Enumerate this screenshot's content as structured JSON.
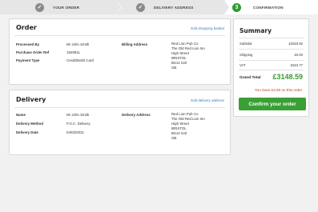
{
  "progress": {
    "steps": [
      {
        "label": "YOUR ORDER",
        "state": "complete"
      },
      {
        "label": "DELIVERY ADDRESS",
        "state": "complete"
      },
      {
        "label": "CONFIRMATION",
        "state": "current",
        "number": "3"
      }
    ],
    "check_glyph": "✓"
  },
  "order": {
    "title": "Order",
    "edit_label": "Edit shopping basket",
    "fields": [
      {
        "label": "Processed By",
        "value": "Mr John Smith"
      },
      {
        "label": "Purchase Order Ref",
        "value": "1629911"
      },
      {
        "label": "Payment Type",
        "value": "Credit/Debit Card"
      }
    ],
    "billing_label": "Billing Address",
    "billing_lines": [
      "Red Lion Pub Co",
      "The Old Red Lion Inn",
      "High Street",
      "BRISTOL",
      "BS14 0JZ",
      "GB"
    ]
  },
  "delivery": {
    "title": "Delivery",
    "edit_label": "Edit delivery address",
    "fields": [
      {
        "label": "Name",
        "value": "Mr John Smith"
      },
      {
        "label": "Delivery Method",
        "value": "F.O.C. Delivery"
      },
      {
        "label": "Delivery Date",
        "value": "04/03/2021"
      }
    ],
    "address_label": "Delivery Address",
    "address_lines": [
      "Red Lion Pub Co",
      "The Old Red Lion Inn",
      "High Street",
      "BRISTOL",
      "BS14 0JZ",
      "GB"
    ]
  },
  "summary": {
    "title": "Summary",
    "rows": [
      {
        "label": "Subtotal",
        "value": "£2623.82"
      },
      {
        "label": "Shipping",
        "value": "£0.00"
      },
      {
        "label": "VAT",
        "value": "£524.77"
      }
    ],
    "grand_total_label": "Grand Total",
    "grand_total_value": "£3148.59",
    "savings_text": "You Save £2.50 on this order.",
    "confirm_label": "Confirm your order"
  },
  "colors": {
    "accent_green": "#3aa035",
    "link_blue": "#3a7ec0",
    "savings_red": "#c0392b",
    "step_grey": "#8a8a8a"
  }
}
